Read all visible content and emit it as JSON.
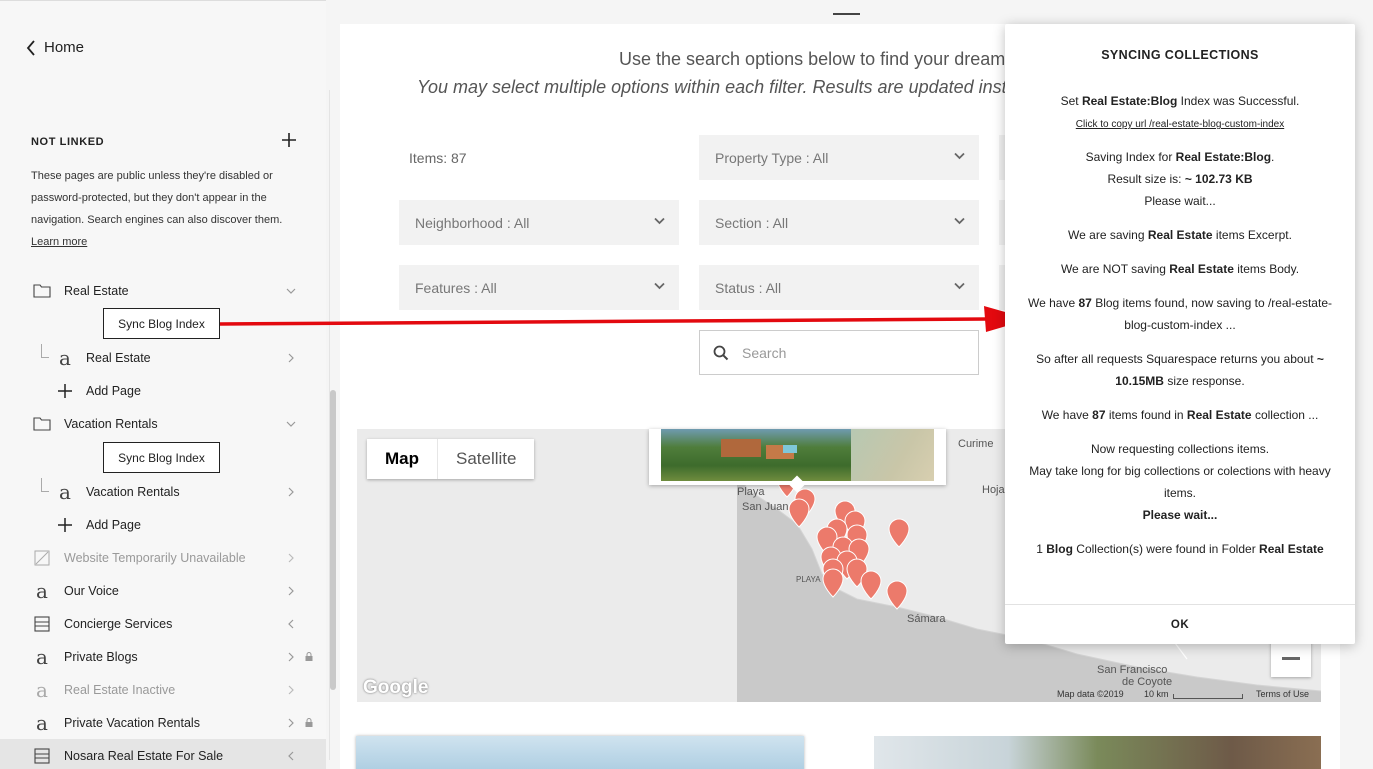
{
  "sidebar": {
    "home_label": "Home",
    "not_linked": {
      "title": "NOT LINKED",
      "description": "These pages are public unless they're disabled or password-protected, but they don't appear in the navigation. Search engines can also discover them.",
      "learn_more": "Learn more"
    },
    "sync_button_label": "Sync Blog Index",
    "items": [
      {
        "label": "Real Estate",
        "icon": "folder-icon"
      },
      {
        "label": "Real Estate",
        "icon": "blog-page-icon"
      },
      {
        "label": "Add Page",
        "icon": "plus-icon"
      },
      {
        "label": "Vacation Rentals",
        "icon": "folder-icon"
      },
      {
        "label": "Vacation Rentals",
        "icon": "blog-page-icon"
      },
      {
        "label": "Add Page",
        "icon": "plus-icon"
      },
      {
        "label": "Website Temporarily Unavailable",
        "icon": "disabled-page-icon"
      },
      {
        "label": "Our Voice",
        "icon": "blog-page-icon"
      },
      {
        "label": "Concierge Services",
        "icon": "index-page-icon"
      },
      {
        "label": "Private Blogs",
        "icon": "blog-page-icon"
      },
      {
        "label": "Real Estate Inactive",
        "icon": "blog-page-icon"
      },
      {
        "label": "Private Vacation Rentals",
        "icon": "blog-page-icon"
      },
      {
        "label": "Nosara Real Estate For Sale",
        "icon": "index-page-icon"
      }
    ]
  },
  "main": {
    "intro_line1": "Use the search options below to find your dream pr",
    "intro_line2": "You may select multiple options within each filter. Results are updated instantly b",
    "items_count": "Items: 87",
    "filters": {
      "property_type": "Property Type : All",
      "neighborhood": "Neighborhood : All",
      "section": "Section : All",
      "features": "Features : All",
      "status": "Status : All"
    },
    "search_placeholder": "Search",
    "map": {
      "map_tab": "Map",
      "satellite_tab": "Satellite",
      "labels": {
        "playa": "Playa",
        "san_juan": "San Juan",
        "playa_caps": "PLAYA",
        "curime": "Curime",
        "hoja": "Hoja",
        "samara": "Sámara",
        "san_francisco": "San Francisco",
        "de_coyote": "de Coyote"
      },
      "google": "Google",
      "map_data": "Map data ©2019",
      "scale": "10 km",
      "terms": "Terms of Use"
    }
  },
  "dialog": {
    "title": "SYNCING COLLECTIONS",
    "messages": {
      "m1a": "Set ",
      "m1b": "Real Estate:Blog",
      "m1c": " Index was Successful.",
      "copy_url": "Click to copy url /real-estate-blog-custom-index",
      "m2a": "Saving Index for ",
      "m2b": "Real Estate:Blog",
      "m2c": ".",
      "m2d": "Result size is: ",
      "m2e": "~ 102.73 KB",
      "m2f": "Please wait...",
      "m3a": "We are saving ",
      "m3b": "Real Estate",
      "m3c": " items Excerpt.",
      "m4a": "We are NOT saving ",
      "m4b": "Real Estate",
      "m4c": " items Body.",
      "m5a": "We have ",
      "m5b": "87",
      "m5c": " Blog items found, now saving to /real-estate-blog-custom-index ...",
      "m6a": "So after all requests Squarespace returns you about ",
      "m6b": "~ 10.15MB",
      "m6c": " size response.",
      "m7a": "We have ",
      "m7b": "87",
      "m7c": " items found in ",
      "m7d": "Real Estate",
      "m7e": " collection ...",
      "m8a": "Now requesting collections items.",
      "m8b": "May take long for big collections or colections with heavy items.",
      "m8c": "Please wait...",
      "m9a": "1 ",
      "m9b": "Blog",
      "m9c": " Collection(s) were found in Folder ",
      "m9d": "Real Estate"
    },
    "ok_label": "OK"
  },
  "colors": {
    "arrow": "#e3090f",
    "map_marker": "#ec7a6b",
    "map_land": "#ebebeb",
    "map_water": "#c7c7c7"
  }
}
